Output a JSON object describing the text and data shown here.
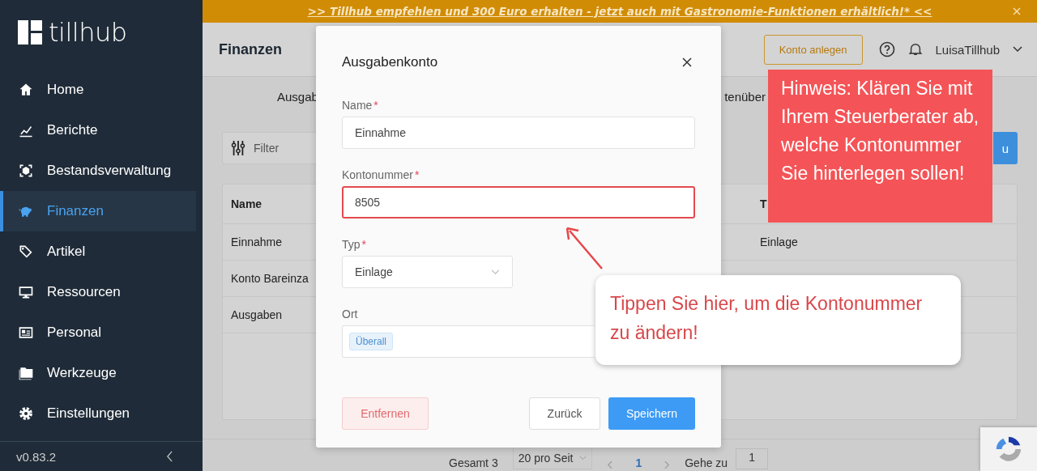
{
  "banner": {
    "text": ">> Tillhub empfehlen und 300 Euro erhalten - jetzt auch mit Gastronomie-Funktionen erhältlich!* <<"
  },
  "sidebar": {
    "logo": "tillhub",
    "items": [
      {
        "label": "Home",
        "selected": false
      },
      {
        "label": "Berichte",
        "selected": false
      },
      {
        "label": "Bestandsverwaltung",
        "selected": false
      },
      {
        "label": "Finanzen",
        "selected": true
      },
      {
        "label": "Artikel",
        "selected": false
      },
      {
        "label": "Ressourcen",
        "selected": false
      },
      {
        "label": "Personal",
        "selected": false
      },
      {
        "label": "Werkzeuge",
        "selected": false
      },
      {
        "label": "Einstellungen",
        "selected": false
      }
    ],
    "version": "v0.83.2"
  },
  "header": {
    "title": "Finanzen",
    "create_button": "Konto anlegen",
    "user": "LuisaTillhub"
  },
  "tabs": [
    "Ausgab",
    "tenüber"
  ],
  "filter": {
    "label": "Filter"
  },
  "new_button": "u",
  "table": {
    "columns": [
      "Name",
      "T"
    ],
    "rows": [
      {
        "name": "Einnahme",
        "type": "Einlage"
      },
      {
        "name": "Konto Bareinza"
      },
      {
        "name": "Ausgaben"
      }
    ]
  },
  "pagination": {
    "total": "Gesamt 3",
    "page_size": "20 pro Seit",
    "current_page": "1",
    "goto_label": "Gehe zu",
    "goto_value": "1"
  },
  "modal": {
    "title": "Ausgabenkonto",
    "fields": [
      {
        "kind": "text",
        "label": "Name",
        "mark": "*",
        "value": "Einnahme",
        "highlighted": false
      },
      {
        "kind": "text",
        "label": "Kontonummer",
        "mark": "*",
        "value": "8505",
        "highlighted": true
      },
      {
        "kind": "select",
        "label": "Typ",
        "mark": "*",
        "value": "Einlage"
      },
      {
        "kind": "tags",
        "label": "Ort",
        "tags": [
          "Überall"
        ]
      }
    ],
    "remove_button": "Entfernen",
    "back_button": "Zurück",
    "save_button": "Speichern"
  },
  "hint": {
    "text": "Hinweis: Klären Sie mit Ihrem Steuerberater ab, welche Kontonummer Sie hinterlegen sollen!"
  },
  "tooltip": {
    "text": "Tippen Sie hier, um die Kontonummer zu ändern!"
  }
}
